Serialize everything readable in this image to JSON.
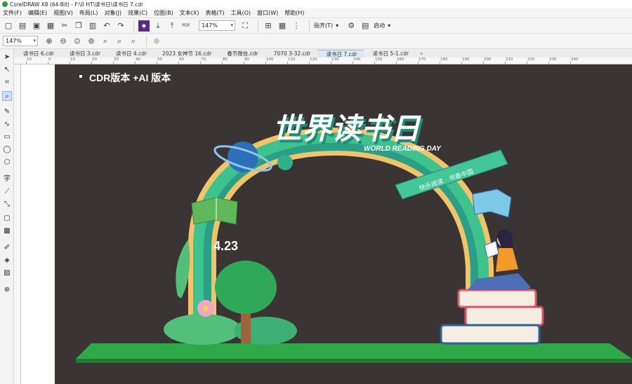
{
  "app": {
    "title": "CorelDRAW X8 (64-Bit) - F:\\0 HT\\读书日\\读书日 7.cdr"
  },
  "menu": [
    "文件(F)",
    "编辑(E)",
    "视图(V)",
    "布局(L)",
    "对象(J)",
    "效果(C)",
    "位图(B)",
    "文本(X)",
    "表格(T)",
    "工具(O)",
    "窗口(W)",
    "帮助(H)"
  ],
  "toolbar": {
    "zoom_value": "147%",
    "zoom_value2": "147%",
    "snap_label": "贴齐(T)",
    "launch_label": "启动"
  },
  "tabs": [
    "读书日 6.cdr",
    "读书日 3.cdr",
    "读书日 4.cdr",
    "2023 女神节 16.cdr",
    "春节微信.cdr",
    "7070 3-32.cdr",
    "读书日 7.cdr",
    "读书日 5-1.cdr"
  ],
  "active_tab": "读书日 7.cdr",
  "ruler_labels": [
    "10",
    "0",
    "10",
    "20",
    "30",
    "40",
    "50",
    "60",
    "70",
    "80",
    "90",
    "100",
    "110",
    "120",
    "130",
    "140",
    "150",
    "160",
    "170",
    "180",
    "190",
    "200",
    "210",
    "220",
    "230",
    "240"
  ],
  "artwork": {
    "version_label": "CDR版本 +AI 版本",
    "title_cn": "世界读书日",
    "title_en": "WORLD READING DAY",
    "ribbon_text": "快乐阅读 · 书香中国",
    "date": "4.23",
    "colors": {
      "background": "#3a3434",
      "arch_green": "#3ec38f",
      "arch_teal": "#2a9f86",
      "arch_outline": "#f2c46a",
      "ground_green": "#2fa847",
      "planet_blue": "#2d6fb8",
      "title_white": "#ffffff",
      "title_teal": "#1f8b7a"
    }
  }
}
